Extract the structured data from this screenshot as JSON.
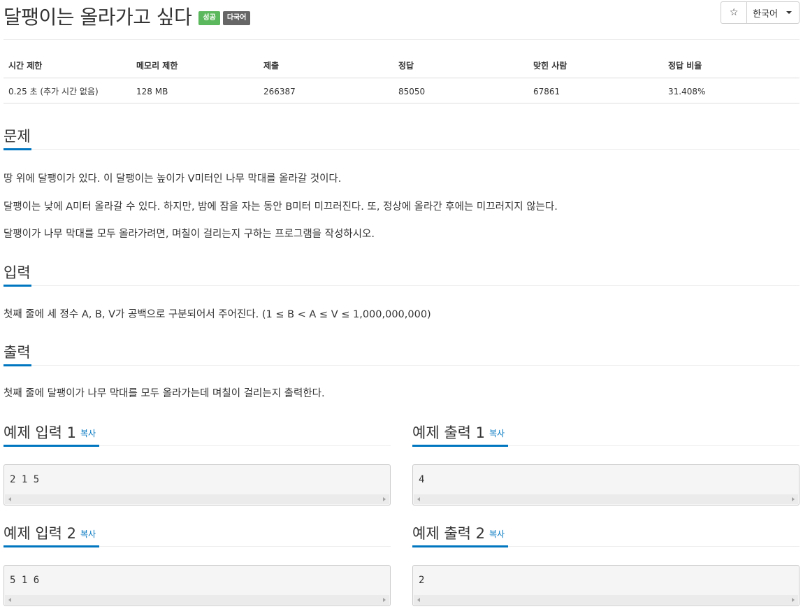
{
  "header": {
    "title": "달팽이는 올라가고 싶다",
    "badge_success": "성공",
    "badge_lang": "다국어",
    "star_icon": "☆",
    "language": "한국어"
  },
  "info": {
    "headers": [
      "시간 제한",
      "메모리 제한",
      "제출",
      "정답",
      "맞힌 사람",
      "정답 비율"
    ],
    "values": [
      "0.25 초 (추가 시간 없음)",
      "128 MB",
      "266387",
      "85050",
      "67861",
      "31.408%"
    ]
  },
  "problem": {
    "title": "문제",
    "paragraphs": [
      "땅 위에 달팽이가 있다. 이 달팽이는 높이가 V미터인 나무 막대를 올라갈 것이다.",
      "달팽이는 낮에 A미터 올라갈 수 있다. 하지만, 밤에 잠을 자는 동안 B미터 미끄러진다. 또, 정상에 올라간 후에는 미끄러지지 않는다.",
      "달팽이가 나무 막대를 모두 올라가려면, 며칠이 걸리는지 구하는 프로그램을 작성하시오."
    ]
  },
  "input": {
    "title": "입력",
    "text": "첫째 줄에 세 정수 A, B, V가 공백으로 구분되어서 주어진다. (1 ≤ B < A ≤ V ≤ 1,000,000,000)"
  },
  "output": {
    "title": "출력",
    "text": "첫째 줄에 달팽이가 나무 막대를 모두 올라가는데 며칠이 걸리는지 출력한다."
  },
  "samples": {
    "copy_label": "복사",
    "input1": {
      "title": "예제 입력 1",
      "content": "2 1 5"
    },
    "output1": {
      "title": "예제 출력 1",
      "content": "4"
    },
    "input2": {
      "title": "예제 입력 2",
      "content": "5 1 6"
    },
    "output2": {
      "title": "예제 출력 2",
      "content": "2"
    }
  },
  "colors": {
    "accent": "#0076c0",
    "badge_success": "#5cb85c",
    "badge_lang": "#666666"
  }
}
